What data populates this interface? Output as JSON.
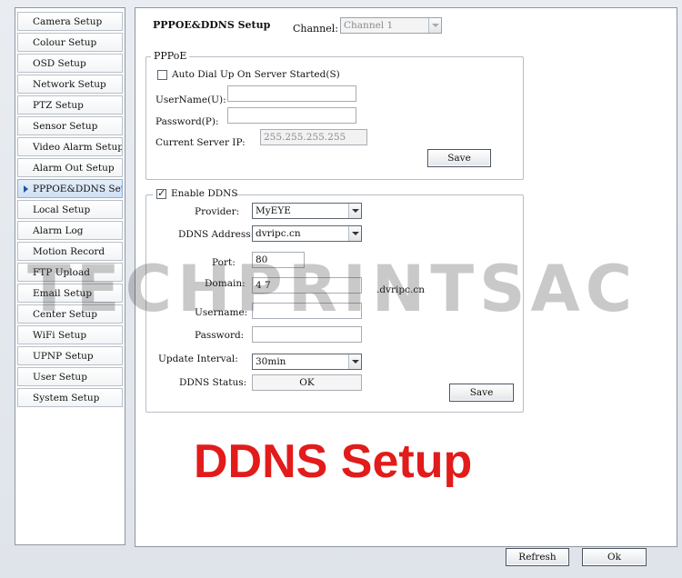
{
  "sidebar": {
    "items": [
      {
        "label": "Camera Setup"
      },
      {
        "label": "Colour Setup"
      },
      {
        "label": "OSD Setup"
      },
      {
        "label": "Network Setup"
      },
      {
        "label": "PTZ Setup"
      },
      {
        "label": "Sensor Setup"
      },
      {
        "label": "Video Alarm Setup"
      },
      {
        "label": "Alarm Out Setup"
      },
      {
        "label": "PPPOE&DDNS Setup",
        "active": true
      },
      {
        "label": "Local Setup"
      },
      {
        "label": "Alarm Log"
      },
      {
        "label": "Motion Record"
      },
      {
        "label": "FTP Upload"
      },
      {
        "label": "Email Setup"
      },
      {
        "label": "Center Setup"
      },
      {
        "label": "WiFi Setup"
      },
      {
        "label": "UPNP Setup"
      },
      {
        "label": "User Setup"
      },
      {
        "label": "System Setup"
      }
    ]
  },
  "header": {
    "title": "PPPOE&DDNS Setup",
    "channel_label": "Channel:",
    "channel_value": "Channel 1"
  },
  "pppoe": {
    "legend": "PPPoE",
    "auto_dial_label": "Auto Dial Up On Server Started(S)",
    "auto_dial_checked": false,
    "username_label": "UserName(U):",
    "username_value": "",
    "password_label": "Password(P):",
    "password_value": "",
    "server_ip_label": "Current Server IP:",
    "server_ip_value": "255.255.255.255",
    "save_label": "Save"
  },
  "ddns": {
    "enable_label": "Enable DDNS",
    "enable_checked": true,
    "provider_label": "Provider:",
    "provider_value": "MyEYE",
    "address_label": "DDNS Address:",
    "address_value": "dvripc.cn",
    "port_label": "Port:",
    "port_value": "80",
    "domain_label": "Domain:",
    "domain_value": "4  7",
    "domain_suffix": ".dvripc.cn",
    "username_label": "Username:",
    "username_value": "",
    "password_label": "Password:",
    "password_value": "",
    "interval_label": "Update Interval:",
    "interval_value": "30min",
    "status_label": "DDNS Status:",
    "status_value": "OK",
    "save_label": "Save"
  },
  "footer": {
    "refresh_label": "Refresh",
    "ok_label": "Ok"
  },
  "overlay": {
    "watermark": "TECHPRINTSAC",
    "caption": "DDNS Setup",
    "caption_color": "#e21b1b"
  }
}
